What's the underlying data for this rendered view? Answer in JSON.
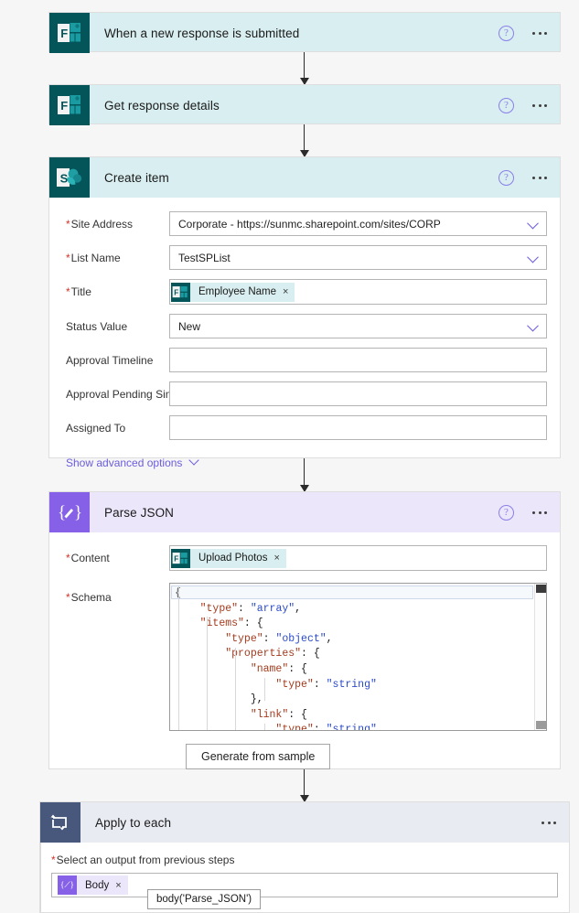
{
  "flow": {
    "steps": [
      {
        "id": "trigger",
        "title": "When a new response is submitted",
        "icon": "microsoft-forms-icon",
        "help_label": "?",
        "menu_label": "More commands"
      },
      {
        "id": "get-response",
        "title": "Get response details",
        "icon": "microsoft-forms-icon",
        "help_label": "?",
        "menu_label": "More commands"
      },
      {
        "id": "create-item",
        "title": "Create item",
        "icon": "sharepoint-icon",
        "help_label": "?",
        "menu_label": "More commands"
      },
      {
        "id": "parse-json",
        "title": "Parse JSON",
        "icon": "parse-json-icon",
        "help_label": "?",
        "menu_label": "More commands"
      },
      {
        "id": "apply-to-each",
        "title": "Apply to each",
        "icon": "loop-icon",
        "menu_label": "More commands"
      }
    ]
  },
  "create_item": {
    "fields": [
      {
        "label": "Site Address",
        "required": true,
        "value": "Corporate - https://sunmc.sharepoint.com/sites/CORP",
        "type": "dropdown"
      },
      {
        "label": "List Name",
        "required": true,
        "value": "TestSPList",
        "type": "dropdown"
      },
      {
        "label": "Title",
        "required": true,
        "type": "token",
        "token": {
          "text": "Employee Name",
          "remove": "×",
          "source": "microsoft-forms-icon"
        }
      },
      {
        "label": "Status Value",
        "required": false,
        "value": "New",
        "type": "dropdown"
      },
      {
        "label": "Approval Timeline",
        "required": false,
        "value": "",
        "type": "text"
      },
      {
        "label": "Approval Pending Since",
        "required": false,
        "value": "",
        "type": "text"
      },
      {
        "label": "Assigned To",
        "required": false,
        "value": "",
        "type": "text"
      }
    ],
    "advanced_options_label": "Show advanced options"
  },
  "parse_json": {
    "content_label": "Content",
    "content_required": true,
    "content_token": {
      "text": "Upload Photos",
      "remove": "×",
      "source": "microsoft-forms-icon"
    },
    "schema_label": "Schema",
    "schema_required": true,
    "schema_lines": [
      "{",
      "    \"type\": \"array\",",
      "    \"items\": {",
      "        \"type\": \"object\",",
      "        \"properties\": {",
      "            \"name\": {",
      "                \"type\": \"string\"",
      "            },",
      "            \"link\": {",
      "                \"type\": \"string\""
    ],
    "generate_button": "Generate from sample"
  },
  "apply_to_each": {
    "select_label": "Select an output from previous steps",
    "select_required": true,
    "token": {
      "text": "Body",
      "remove": "×",
      "source": "parse-json-icon"
    },
    "tooltip": "body('Parse_JSON')"
  },
  "colors": {
    "forms_teal": "#04555a",
    "forms_card_header": "#d9eef0",
    "sharepoint_card_header": "#d9eef0",
    "parse_json_purple": "#8661e8",
    "parse_json_card_header": "#ece6fb",
    "loop_blue": "#48587c",
    "loop_card_header": "#e8ebf2",
    "required_red": "#d6322a",
    "link_purple": "#6b5ce0",
    "canvas_bg": "#f6f6f6"
  }
}
